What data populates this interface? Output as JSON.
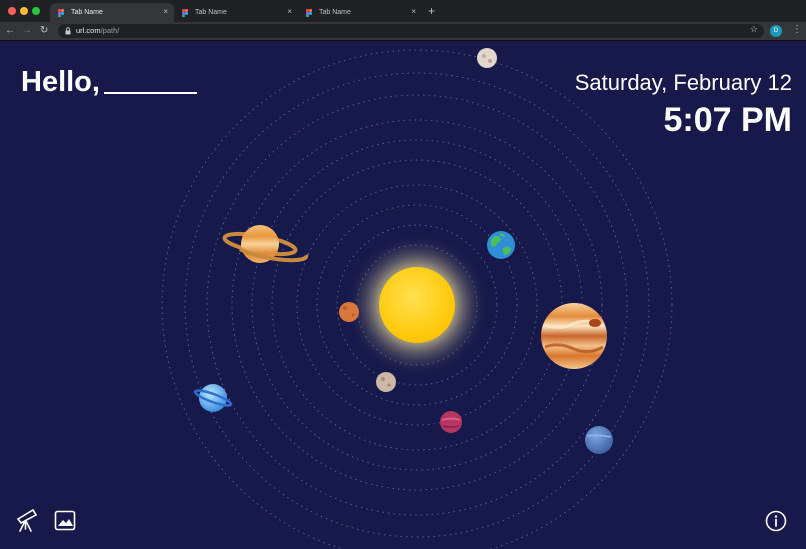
{
  "browser": {
    "tabs": [
      {
        "label": "Tab Name",
        "active": true
      },
      {
        "label": "Tab Name",
        "active": false
      },
      {
        "label": "Tab Name",
        "active": false
      }
    ],
    "tab_close_glyph": "×",
    "new_tab_glyph": "+",
    "url_host": "url.com",
    "url_path": "/path/",
    "profile_initial": "D",
    "colors": {
      "tabbar": "#202124",
      "toolbar": "#35363a",
      "profile": "#1a9bb5"
    }
  },
  "page": {
    "greeting": "Hello,",
    "date": "Saturday, February 12",
    "time": "5:07 PM",
    "background": "#16194a"
  },
  "bottom_icons": {
    "left": [
      "telescope-icon",
      "image-icon"
    ],
    "right": [
      "info-icon"
    ]
  }
}
